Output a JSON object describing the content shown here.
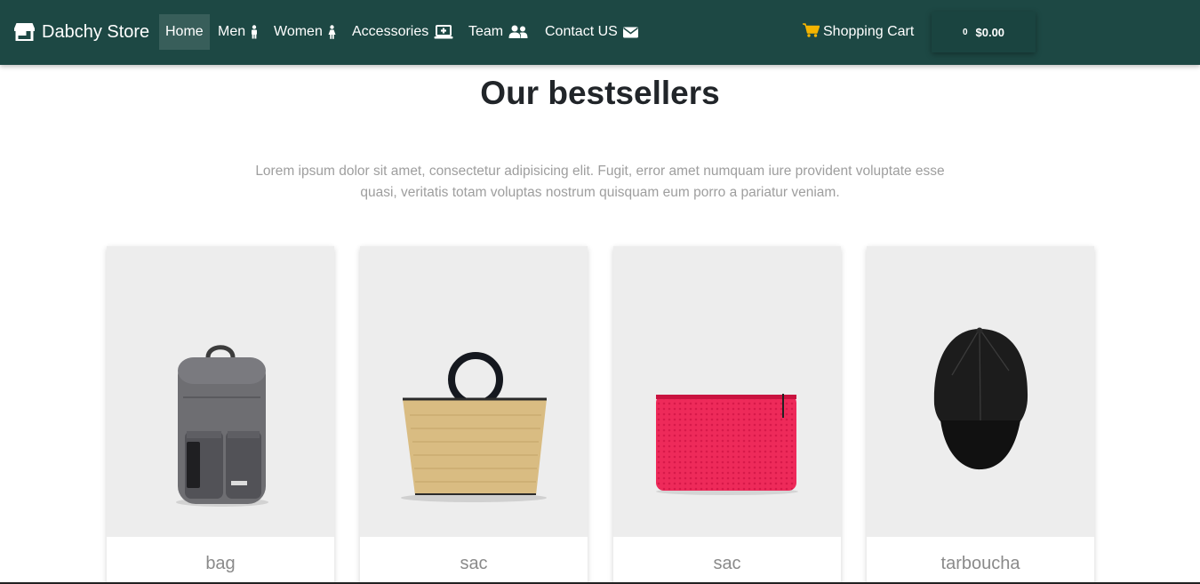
{
  "brand": {
    "name": "Dabchy Store",
    "icon": "store-icon"
  },
  "nav": {
    "items": [
      {
        "label": "Home",
        "icon": "",
        "active": true
      },
      {
        "label": "Men",
        "icon": "male-icon"
      },
      {
        "label": "Women",
        "icon": "female-icon"
      },
      {
        "label": "Accessories",
        "icon": "laptop-medical-icon"
      },
      {
        "label": "Team",
        "icon": "users-icon"
      },
      {
        "label": "Contact US",
        "icon": "envelope-icon"
      }
    ],
    "cart_label": "Shopping Cart",
    "cart_icon": "shopping-cart-icon",
    "cart_count": "0",
    "cart_total": "$0.00"
  },
  "main": {
    "title": "Our bestsellers",
    "description": "Lorem ipsum dolor sit amet, consectetur adipisicing elit. Fugit, error amet numquam iure provident voluptate esse quasi, veritatis totam voluptas nostrum quisquam eum porro a pariatur veniam."
  },
  "products": [
    {
      "title": "bag",
      "image": "backpack"
    },
    {
      "title": "sac",
      "image": "straw-handbag"
    },
    {
      "title": "sac",
      "image": "pink-pouch"
    },
    {
      "title": "tarboucha",
      "image": "black-cap"
    }
  ],
  "colors": {
    "navbar": "#1d4844",
    "cart_icon": "#f4b400",
    "card_bg": "#ededed"
  }
}
